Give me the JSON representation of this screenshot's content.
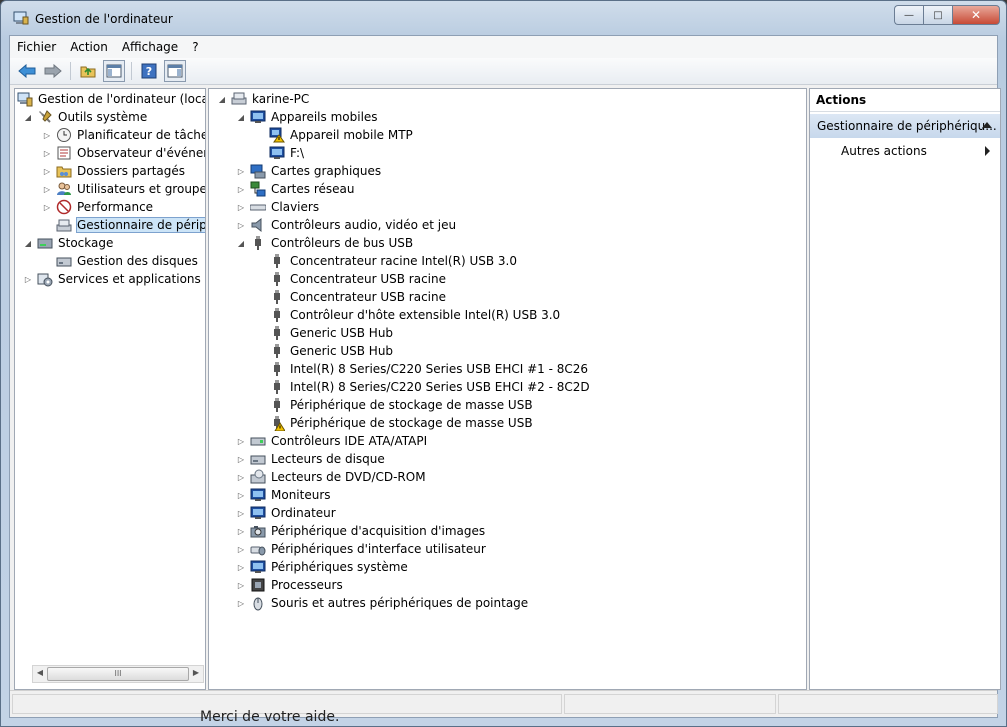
{
  "window": {
    "title": "Gestion de l'ordinateur"
  },
  "caption": {
    "minimize": "—",
    "maximize": "□",
    "close": "✕"
  },
  "menu": {
    "fichier": "Fichier",
    "action": "Action",
    "affichage": "Affichage",
    "help": "?"
  },
  "left_tree": {
    "root": "Gestion de l'ordinateur (local)",
    "outils": "Outils système",
    "planif": "Planificateur de tâches",
    "observ": "Observateur d'événeme",
    "dossiers": "Dossiers partagés",
    "utilisateurs": "Utilisateurs et groupes l",
    "performance": "Performance",
    "gestionnaire": "Gestionnaire de périphé",
    "stockage": "Stockage",
    "disques": "Gestion des disques",
    "services": "Services et applications"
  },
  "scroll_thumb": "III",
  "device_tree": {
    "root": "karine-PC",
    "mobiles": "Appareils mobiles",
    "mtp": "Appareil mobile MTP",
    "f_drive": "F:\\",
    "graphiques": "Cartes graphiques",
    "reseau": "Cartes réseau",
    "claviers": "Claviers",
    "audio": "Contrôleurs audio, vidéo et jeu",
    "usb": "Contrôleurs de bus USB",
    "usb_items": [
      "Concentrateur racine Intel(R) USB 3.0",
      "Concentrateur USB racine",
      "Concentrateur USB racine",
      "Contrôleur d'hôte extensible Intel(R) USB 3.0",
      "Generic USB Hub",
      "Generic USB Hub",
      "Intel(R) 8 Series/C220 Series USB EHCI #1 - 8C26",
      "Intel(R) 8 Series/C220 Series USB EHCI #2 - 8C2D",
      "Périphérique de stockage de masse USB",
      "Périphérique de stockage de masse USB"
    ],
    "ide": "Contrôleurs IDE ATA/ATAPI",
    "lect_disque": "Lecteurs de disque",
    "dvd": "Lecteurs de DVD/CD-ROM",
    "moniteurs": "Moniteurs",
    "ordinateur": "Ordinateur",
    "acquisition": "Périphérique d'acquisition d'images",
    "hid": "Périphériques d'interface utilisateur",
    "systeme": "Périphériques système",
    "processeurs": "Processeurs",
    "souris": "Souris et autres périphériques de pointage"
  },
  "actions": {
    "header": "Actions",
    "group": "Gestionnaire de périphériqu...",
    "autres": "Autres actions"
  },
  "background_text": "Merci de votre aide.",
  "colors": {
    "selection": "#cce4f7",
    "warning": "#f2c200",
    "usb_plug": "#555555"
  }
}
